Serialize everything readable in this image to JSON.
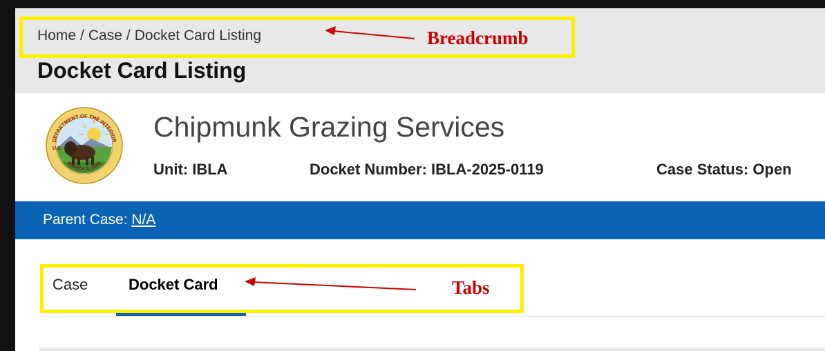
{
  "breadcrumb": {
    "items": [
      "Home",
      "Case",
      "Docket Card Listing"
    ],
    "separator": "/"
  },
  "page": {
    "title": "Docket Card Listing"
  },
  "case": {
    "name": "Chipmunk Grazing Services",
    "unit_label": "Unit:",
    "unit_value": "IBLA",
    "docket_label": "Docket Number:",
    "docket_value": "IBLA-2025-0119",
    "status_label": "Case Status:",
    "status_value": "Open",
    "seal": {
      "icon": "department-of-interior-seal",
      "top_text": "DEPARTMENT OF THE INTERIOR",
      "left_text": "U.S.",
      "bottom_text": "MARCH 3, 1849"
    }
  },
  "parent_case": {
    "label": "Parent Case:",
    "value": "N/A"
  },
  "tabs": [
    {
      "label": "Case",
      "active": false
    },
    {
      "label": "Docket Card",
      "active": true
    }
  ],
  "annotations": {
    "breadcrumb": "Breadcrumb",
    "tabs": "Tabs"
  },
  "colors": {
    "primary": "#0b63b5",
    "header_band": "#e8e8e8",
    "annotation_box": "#ffee00",
    "annotation_text": "#cc0000"
  }
}
